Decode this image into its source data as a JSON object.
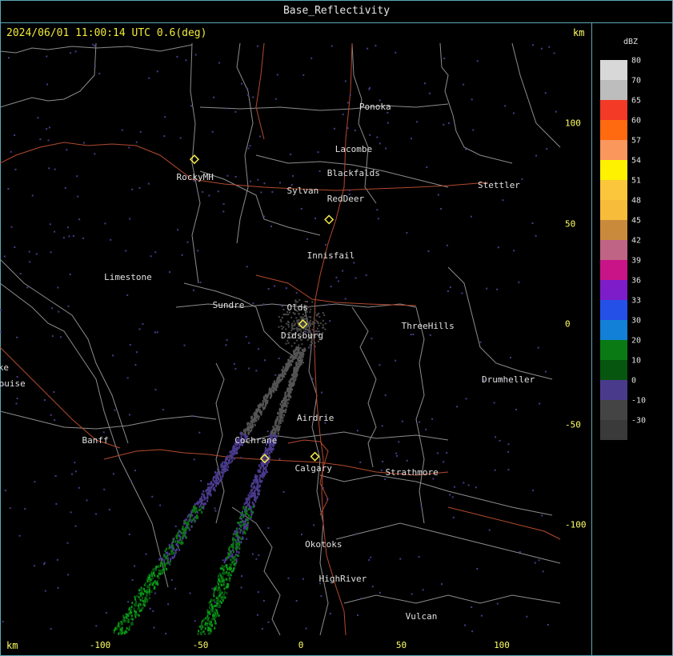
{
  "title": "Base_Reflectivity",
  "timestamp": "2024/06/01 11:00:14 UTC 0.6(deg)",
  "axis_unit_top": "km",
  "axis_unit_bottom": "km",
  "x_ticks": [
    {
      "label": "-100",
      "value": -100
    },
    {
      "label": "-50",
      "value": -50
    },
    {
      "label": "0",
      "value": 0
    },
    {
      "label": "50",
      "value": 50
    },
    {
      "label": "100",
      "value": 100
    }
  ],
  "y_ticks": [
    {
      "label": "100",
      "value": 100
    },
    {
      "label": "50",
      "value": 50
    },
    {
      "label": "0",
      "value": 0
    },
    {
      "label": "-50",
      "value": -50
    },
    {
      "label": "-100",
      "value": -100
    }
  ],
  "places": [
    {
      "name": "Ponoka",
      "x": 37,
      "y": 108
    },
    {
      "name": "Lacombe",
      "x": 25,
      "y": 87
    },
    {
      "name": "Blackfalds",
      "x": 21,
      "y": 75
    },
    {
      "name": "RockyMH",
      "x": -54,
      "y": 73
    },
    {
      "name": "Sylvan",
      "x": 1,
      "y": 66
    },
    {
      "name": "RedDeer",
      "x": 21,
      "y": 62
    },
    {
      "name": "Stettler",
      "x": 96,
      "y": 69
    },
    {
      "name": "Innisfail",
      "x": 11,
      "y": 34
    },
    {
      "name": "Limestone",
      "x": -90,
      "y": 23
    },
    {
      "name": "Sundre",
      "x": -36,
      "y": 9
    },
    {
      "name": "Olds",
      "x": 1,
      "y": 8
    },
    {
      "name": "ThreeHills",
      "x": 58,
      "y": -1
    },
    {
      "name": "Didsburg",
      "x": -2,
      "y": -6
    },
    {
      "name": "Lake",
      "x": -148,
      "y": -22
    },
    {
      "name": "Louise",
      "x": -145,
      "y": -30
    },
    {
      "name": "Drumheller",
      "x": 98,
      "y": -28
    },
    {
      "name": "Airdrie",
      "x": 6,
      "y": -47
    },
    {
      "name": "Banff",
      "x": -101,
      "y": -58
    },
    {
      "name": "Cochrane",
      "x": -25,
      "y": -58
    },
    {
      "name": "Calgary",
      "x": 5,
      "y": -72
    },
    {
      "name": "Strathmore",
      "x": 50,
      "y": -74
    },
    {
      "name": "Okotoks",
      "x": 10,
      "y": -110
    },
    {
      "name": "HighRiver",
      "x": 17,
      "y": -127
    },
    {
      "name": "Vulcan",
      "x": 60,
      "y": -146
    }
  ],
  "radar_sites": [
    {
      "x": -53,
      "y": 82
    },
    {
      "x": 14,
      "y": 52
    },
    {
      "x": 1,
      "y": 0
    },
    {
      "x": -18,
      "y": -67
    },
    {
      "x": 7,
      "y": -66
    }
  ],
  "legend": {
    "unit": "dBZ",
    "levels": [
      {
        "label": "80",
        "color": "#d8d8d8"
      },
      {
        "label": "70",
        "color": "#bdbdbd"
      },
      {
        "label": "65",
        "color": "#f23a26"
      },
      {
        "label": "60",
        "color": "#ff6a10"
      },
      {
        "label": "57",
        "color": "#f9975d"
      },
      {
        "label": "54",
        "color": "#fff200"
      },
      {
        "label": "51",
        "color": "#fcc63c"
      },
      {
        "label": "48",
        "color": "#f6bc3a"
      },
      {
        "label": "45",
        "color": "#c98a3c"
      },
      {
        "label": "42",
        "color": "#c06486"
      },
      {
        "label": "39",
        "color": "#c81487"
      },
      {
        "label": "36",
        "color": "#7d1dc9"
      },
      {
        "label": "33",
        "color": "#2550e8"
      },
      {
        "label": "30",
        "color": "#1180d6"
      },
      {
        "label": "20",
        "color": "#0a7a14"
      },
      {
        "label": "10",
        "color": "#07560f"
      },
      {
        "label": "0",
        "color": "#4a3a8c"
      },
      {
        "label": "-10",
        "color": "#444444"
      },
      {
        "label": "-30",
        "color": "#3a3a3a"
      }
    ]
  },
  "colors": {
    "frame": "#5aa9b8",
    "timestamp": "#f2ea3a",
    "ticks": "#ffff66",
    "county_lines": "#8c8c8c",
    "roads": "#b34a2e",
    "radar_site": "#f4e94a"
  }
}
